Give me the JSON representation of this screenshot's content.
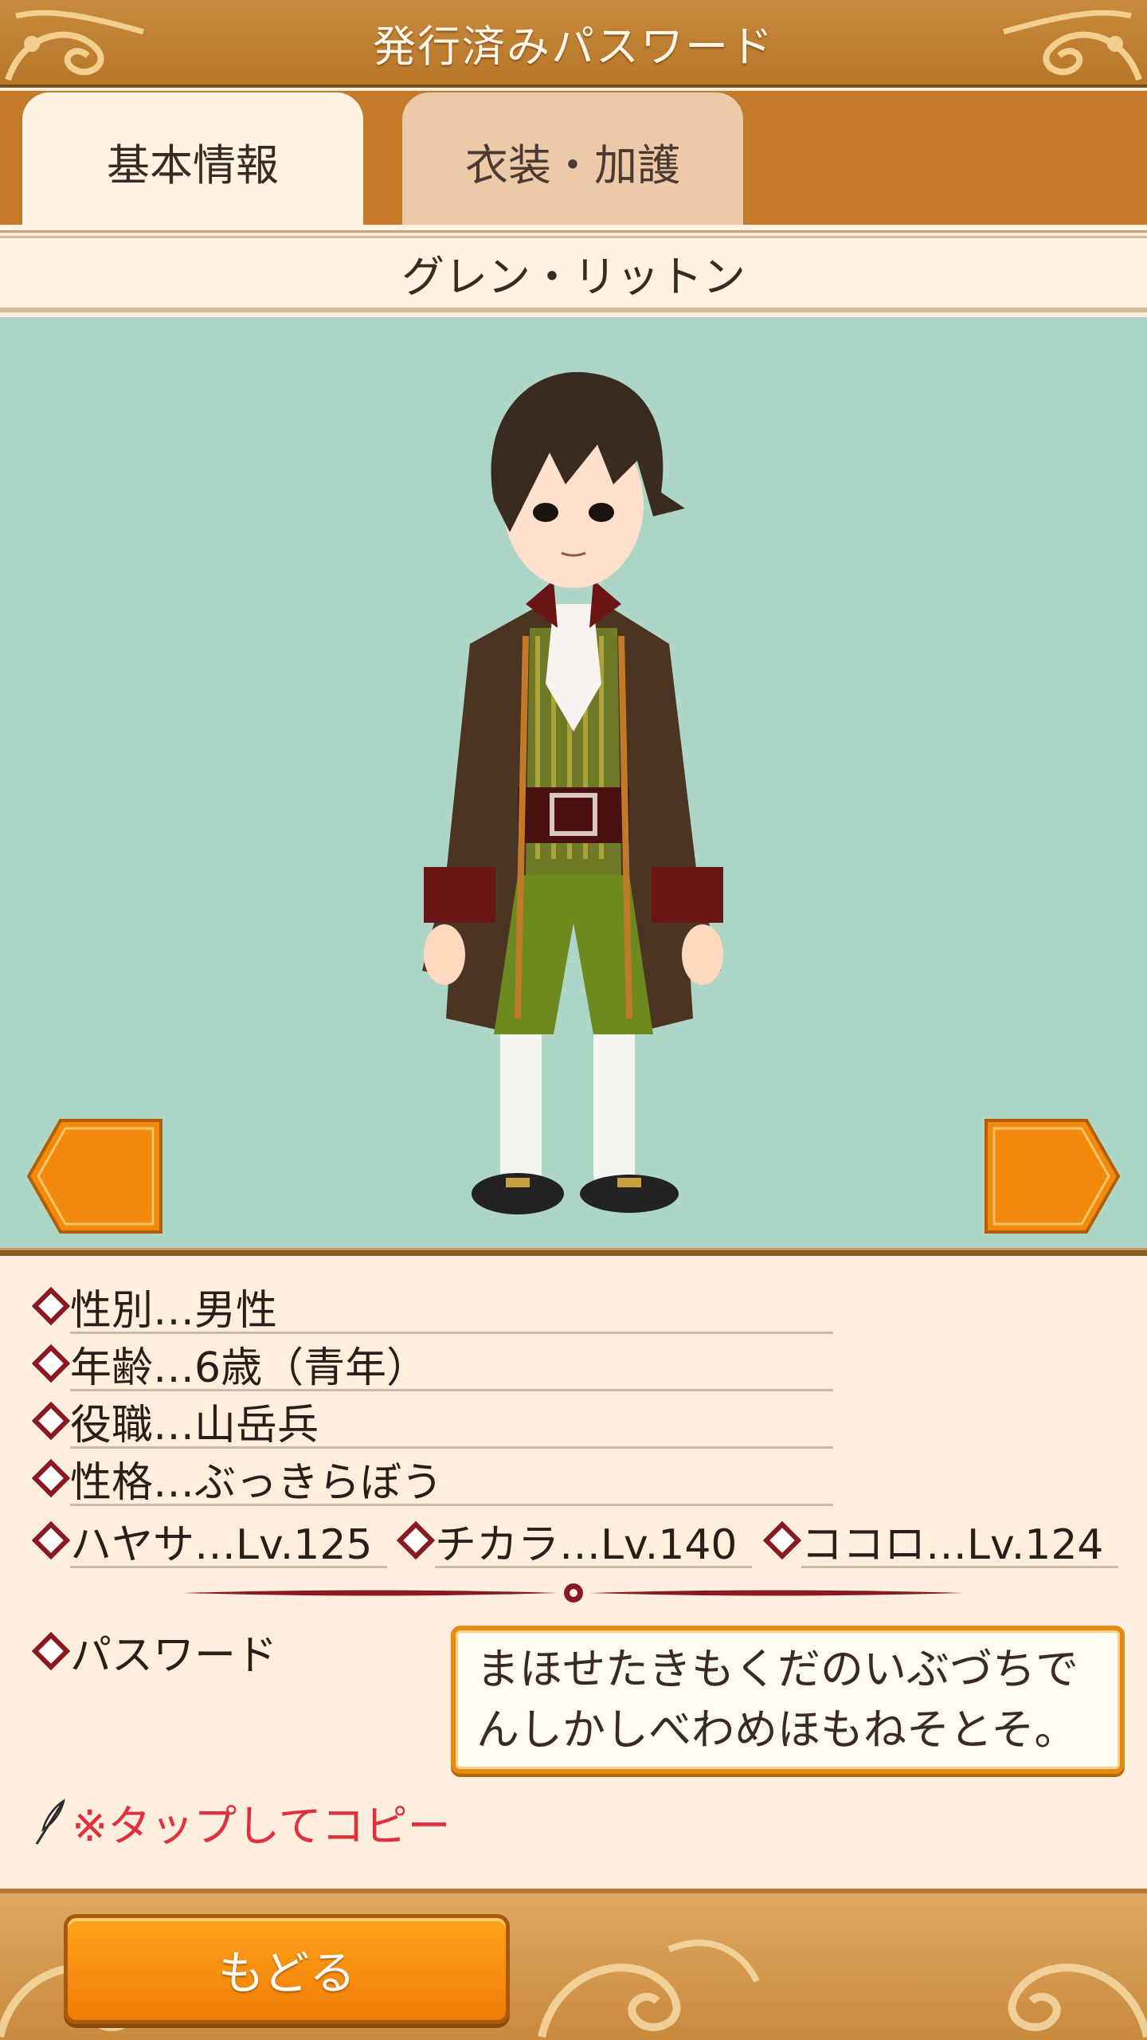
{
  "header": {
    "title": "発行済みパスワード"
  },
  "tabs": [
    {
      "label": "基本情報",
      "active": true
    },
    {
      "label": "衣装・加護",
      "active": false
    }
  ],
  "character": {
    "name": "グレン・リットン"
  },
  "navigation": {
    "prev_icon": "left-arrow-icon",
    "next_icon": "right-arrow-icon"
  },
  "info": {
    "gender": "性別…男性",
    "age": "年齢…6歳（青年）",
    "role": "役職…山岳兵",
    "personality": "性格…ぶっきらぼう"
  },
  "stats": [
    {
      "label": "ハヤサ…Lv.125"
    },
    {
      "label": "チカラ…Lv.140"
    },
    {
      "label": "ココロ…Lv.124"
    }
  ],
  "password": {
    "label": "パスワード",
    "lines": [
      "まほせたきもくだのいぶづちで",
      "んしかしべわめほもねそとそ。"
    ]
  },
  "copy_hint": "※タップしてコピー",
  "footer": {
    "back_label": "もどる"
  },
  "colors": {
    "accent": "#f08a10",
    "header": "#c07a30",
    "viewer_bg": "#add6c7",
    "hint": "#e0303c"
  }
}
